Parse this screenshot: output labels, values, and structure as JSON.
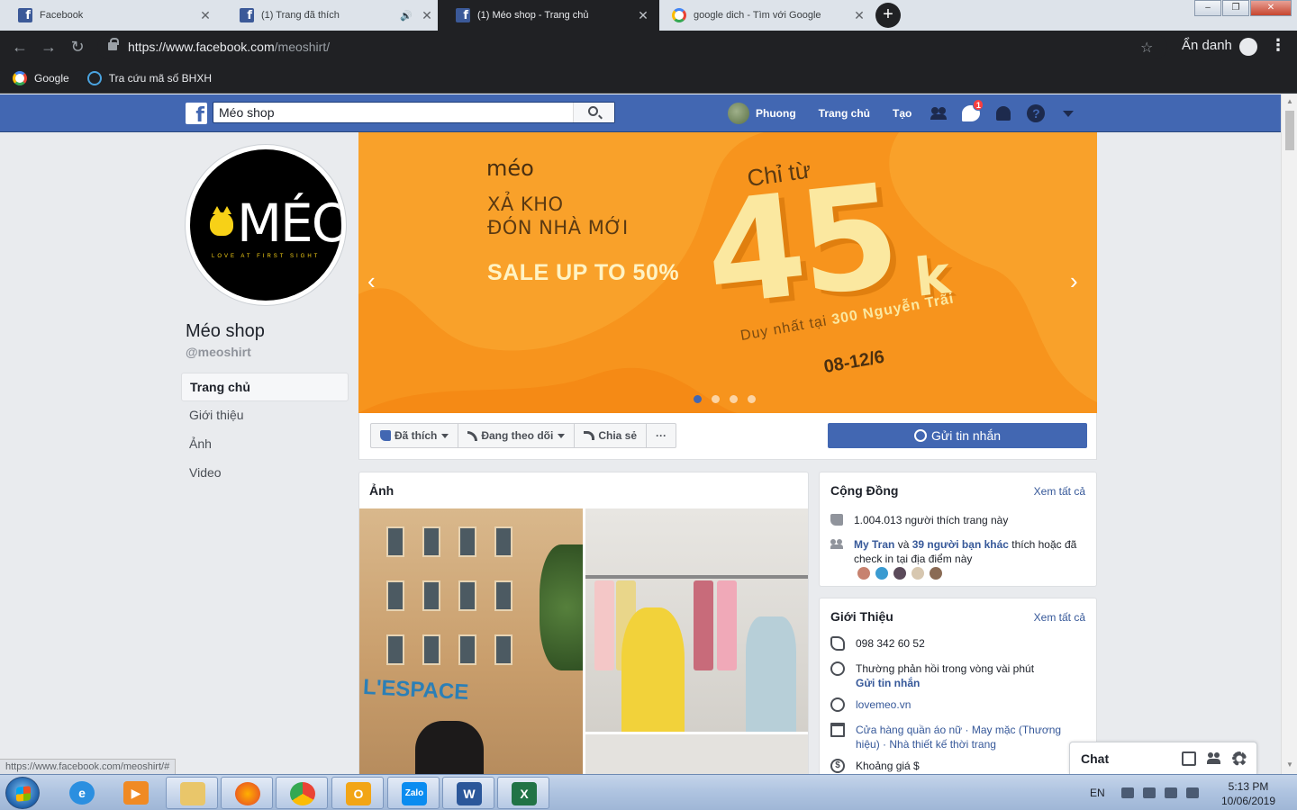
{
  "browser": {
    "tabs": [
      {
        "title": "Facebook",
        "favicon": "facebook-icon",
        "active": false
      },
      {
        "title": "(1) Trang đã thích",
        "favicon": "facebook-icon",
        "active": false,
        "audio": true
      },
      {
        "title": "(1) Méo shop - Trang chủ",
        "favicon": "facebook-icon",
        "active": true
      },
      {
        "title": "google dich - Tìm với Google",
        "favicon": "google-icon",
        "active": false
      }
    ],
    "url_host": "https://www.facebook.com",
    "url_path": "/meoshirt/",
    "incognito_label": "Ẩn danh",
    "bookmarks": [
      {
        "label": "Google",
        "icon": "google-icon"
      },
      {
        "label": "Tra cứu mã số BHXH",
        "icon": "government-icon"
      }
    ],
    "status_url": "https://www.facebook.com/meoshirt/#"
  },
  "fb_header": {
    "search_value": "Méo shop",
    "user_name": "Phuong",
    "nav_home": "Trang chủ",
    "nav_create": "Tạo",
    "messages_badge": "1",
    "brand_color": "#4267b2"
  },
  "page": {
    "profile_logo_text": "MÉO",
    "profile_logo_tagline": "LOVE AT FIRST SIGHT",
    "name": "Méo shop",
    "handle": "@meoshirt",
    "left_nav": [
      "Trang chủ",
      "Giới thiệu",
      "Ảnh",
      "Video"
    ],
    "active_nav": "Trang chủ"
  },
  "cover": {
    "logo": "méo",
    "line1": "XẢ KHO",
    "line2": "ĐÓN NHÀ MỚI",
    "sale": "SALE UP TO 50%",
    "chi_tu": "Chỉ từ",
    "price": "45",
    "price_unit": "k",
    "location_prefix": "Duy nhất tại",
    "location": "300 Nguyễn Trãi",
    "dates": "08-12/6",
    "slide_count": 4,
    "active_slide": 1,
    "background": "#f7941d"
  },
  "actions": {
    "liked": "Đã thích",
    "following": "Đang theo dõi",
    "share": "Chia sẻ",
    "more": "···",
    "send_message": "Gửi tin nhắn"
  },
  "photos": {
    "title": "Ảnh",
    "sign_text": "L'ESPACE"
  },
  "community": {
    "title": "Cộng Đồng",
    "see_all": "Xem tất cả",
    "likes_text": "1.004.013 người thích trang này",
    "friend_name": "My Tran",
    "friend_conj": " và ",
    "friends_count": "39 người bạn khác",
    "friends_suffix": " thích hoặc đã check in tại địa điểm này"
  },
  "intro": {
    "title": "Giới Thiệu",
    "see_all": "Xem tất cả",
    "phone": "098 342 60 52",
    "response": "Thường phản hồi trong vòng vài phút",
    "send_link": "Gửi tin nhắn",
    "website": "lovemeo.vn",
    "categories": "Cửa hàng quần áo nữ · May mặc (Thương hiệu) · Nhà thiết kế thời trang",
    "price_range": "Khoảng giá $"
  },
  "chat": {
    "label": "Chat"
  },
  "taskbar": {
    "apps": [
      "internet-explorer-icon",
      "media-player-icon",
      "file-explorer-icon",
      "firefox-icon",
      "chrome-icon",
      "outlook-icon",
      "zalo-icon",
      "word-icon",
      "excel-icon"
    ],
    "language": "EN",
    "time": "5:13 PM",
    "date": "10/06/2019"
  }
}
